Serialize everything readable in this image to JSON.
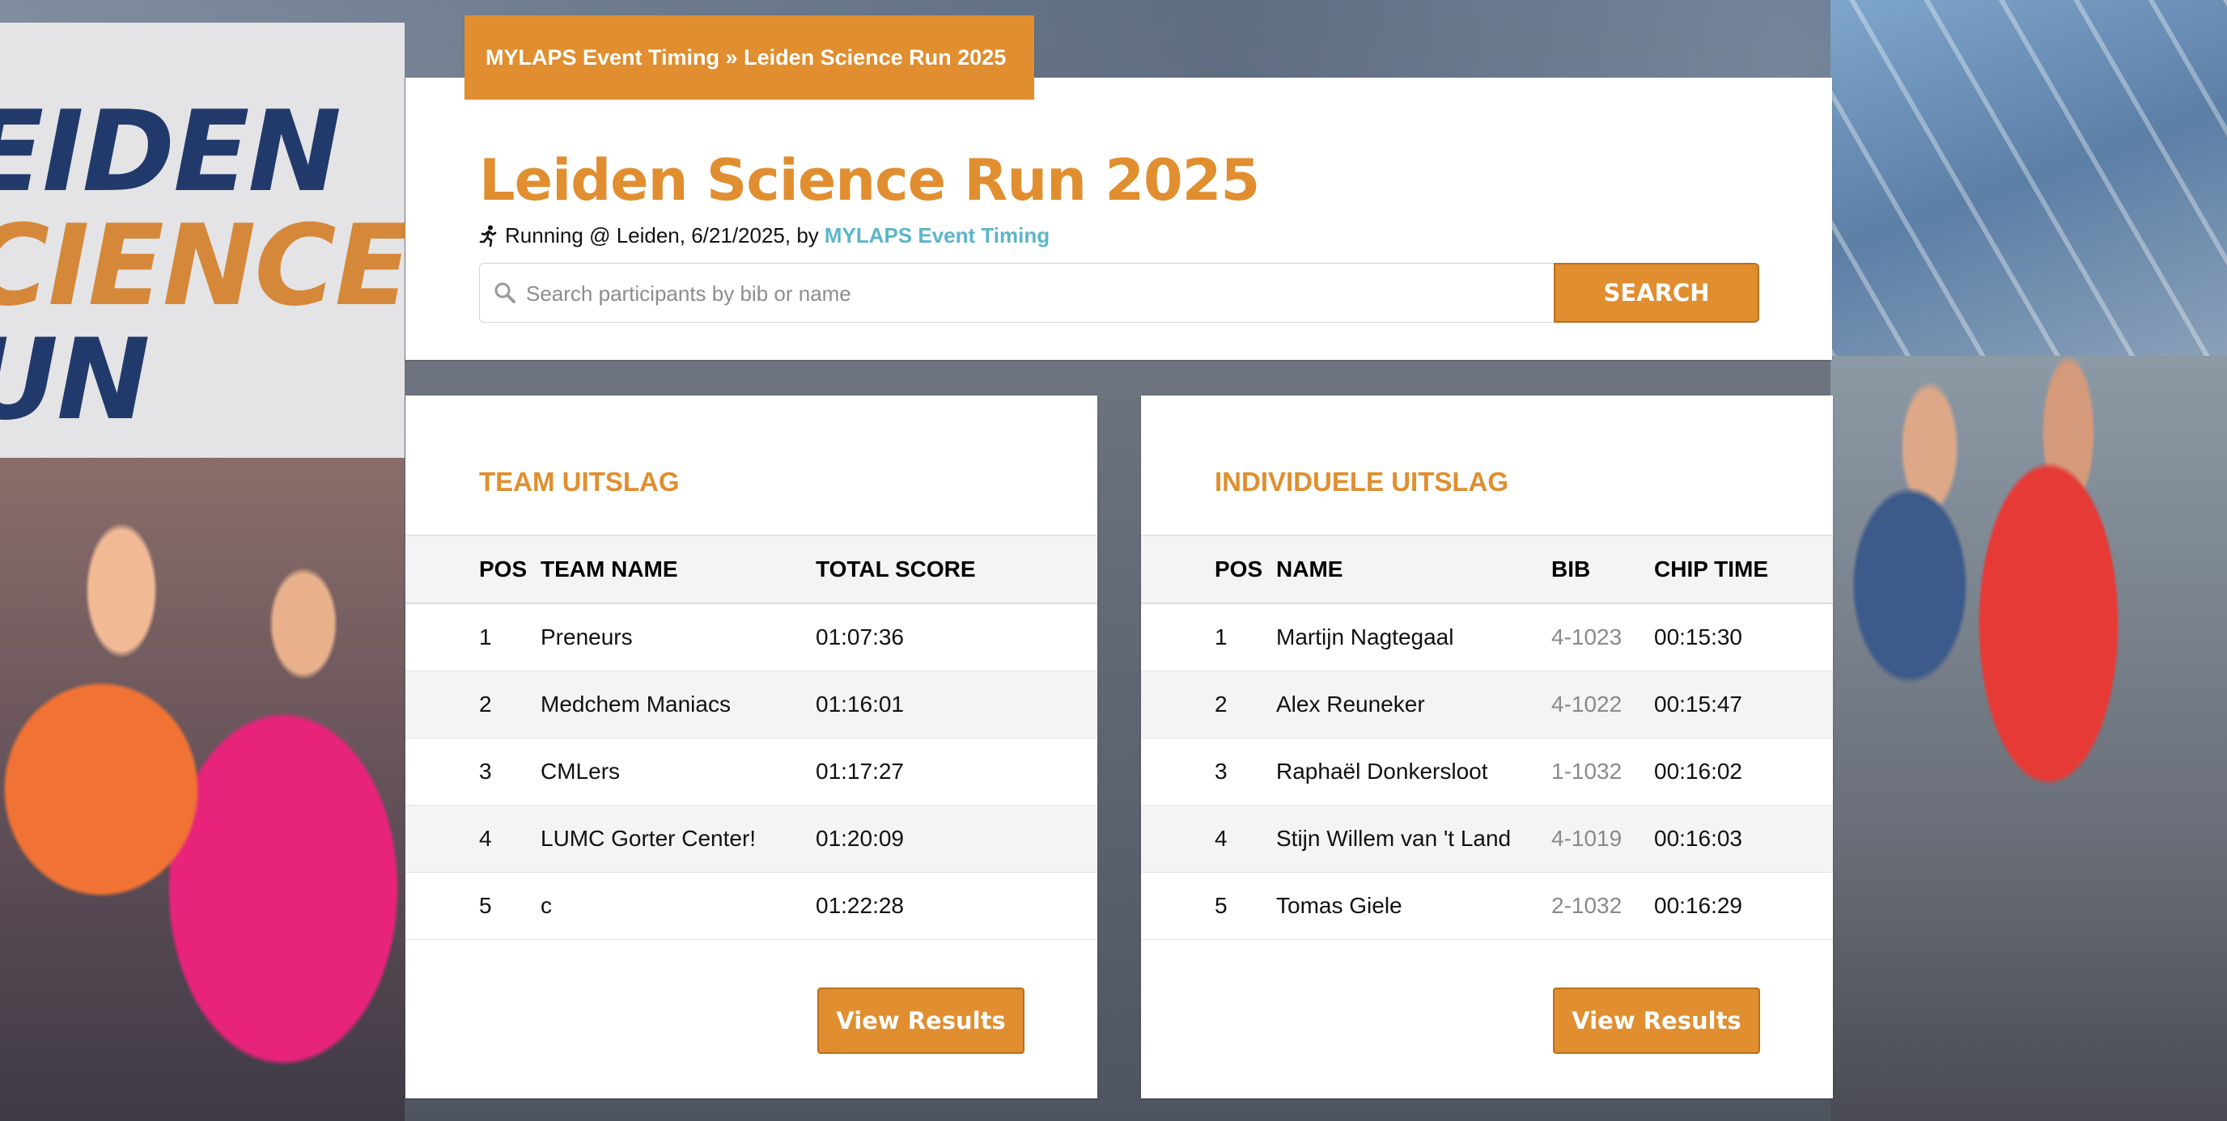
{
  "breadcrumb": {
    "organizer": "MYLAPS Event Timing",
    "separator": " » ",
    "event": "Leiden Science Run 2025"
  },
  "background": {
    "logo_lines": [
      "EIDEN",
      "CIENCE",
      "UN"
    ]
  },
  "event": {
    "title": "Leiden Science Run 2025",
    "subtitle_prefix": "Running @ Leiden, 6/21/2025, by",
    "organizer_link": "MYLAPS Event Timing"
  },
  "search": {
    "placeholder": "Search participants by bib or name",
    "value": "",
    "button_label": "SEARCH"
  },
  "team_results": {
    "heading": "TEAM UITSLAG",
    "columns": [
      "POS",
      "TEAM NAME",
      "TOTAL SCORE"
    ],
    "rows": [
      {
        "pos": "1",
        "name": "Preneurs",
        "score": "01:07:36"
      },
      {
        "pos": "2",
        "name": "Medchem Maniacs",
        "score": "01:16:01"
      },
      {
        "pos": "3",
        "name": "CMLers",
        "score": "01:17:27"
      },
      {
        "pos": "4",
        "name": "LUMC Gorter Center!",
        "score": "01:20:09"
      },
      {
        "pos": "5",
        "name": "c",
        "score": "01:22:28"
      }
    ],
    "button_label": "View Results"
  },
  "individual_results": {
    "heading": "INDIVIDUELE UITSLAG",
    "columns": [
      "POS",
      "NAME",
      "BIB",
      "CHIP TIME"
    ],
    "rows": [
      {
        "pos": "1",
        "name": "Martijn Nagtegaal",
        "bib": "4-1023",
        "time": "00:15:30"
      },
      {
        "pos": "2",
        "name": "Alex Reuneker",
        "bib": "4-1022",
        "time": "00:15:47"
      },
      {
        "pos": "3",
        "name": "Raphaël Donkersloot",
        "bib": "1-1032",
        "time": "00:16:02"
      },
      {
        "pos": "4",
        "name": "Stijn Willem van 't Land",
        "bib": "4-1019",
        "time": "00:16:03"
      },
      {
        "pos": "5",
        "name": "Tomas Giele",
        "bib": "2-1032",
        "time": "00:16:29"
      }
    ],
    "button_label": "View Results"
  },
  "colors": {
    "accent": "#e08e2f",
    "link": "#5bb6c9",
    "row_alt": "#f4f4f4"
  },
  "icons": {
    "runner": "runner-icon",
    "search": "search-icon"
  }
}
